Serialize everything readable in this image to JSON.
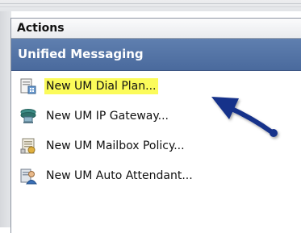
{
  "pane": {
    "header": "Actions",
    "section_title": "Unified Messaging",
    "items": [
      {
        "label": "New UM Dial Plan...",
        "icon": "dial-plan-icon",
        "highlighted": true
      },
      {
        "label": "New UM IP Gateway...",
        "icon": "ip-gateway-icon",
        "highlighted": false
      },
      {
        "label": "New UM Mailbox Policy...",
        "icon": "mailbox-policy-icon",
        "highlighted": false
      },
      {
        "label": "New UM Auto Attendant...",
        "icon": "auto-attendant-icon",
        "highlighted": false
      }
    ]
  },
  "colors": {
    "section_header": "#5574a6",
    "highlight": "#fbfb5a",
    "arrow": "#15308a"
  }
}
